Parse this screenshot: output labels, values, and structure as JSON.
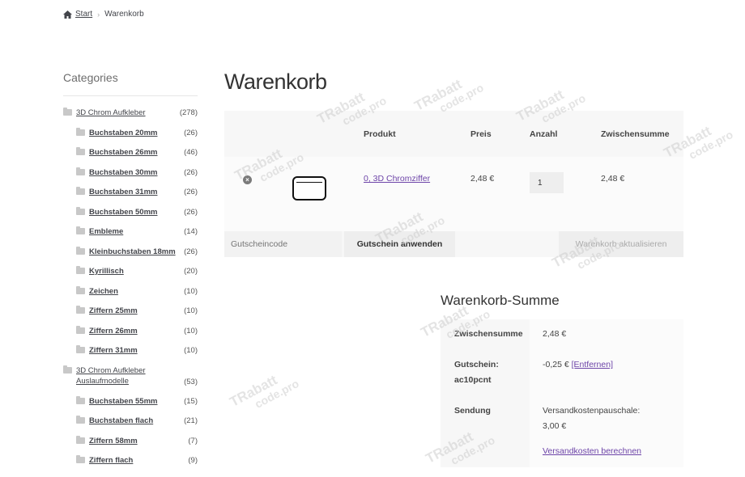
{
  "breadcrumb": {
    "home": "Start",
    "current": "Warenkorb",
    "separator": "›"
  },
  "sidebar": {
    "title": "Categories",
    "categories": [
      {
        "name": "3D Chrom Aufkleber",
        "count": "(278)",
        "level": 0
      },
      {
        "name": "Buchstaben 20mm",
        "count": "(26)",
        "level": 1
      },
      {
        "name": "Buchstaben 26mm",
        "count": "(46)",
        "level": 1
      },
      {
        "name": "Buchstaben 30mm",
        "count": "(26)",
        "level": 1
      },
      {
        "name": "Buchstaben 31mm",
        "count": "(26)",
        "level": 1
      },
      {
        "name": "Buchstaben 50mm",
        "count": "(26)",
        "level": 1
      },
      {
        "name": "Embleme",
        "count": "(14)",
        "level": 1
      },
      {
        "name": "Kleinbuchstaben 18mm",
        "count": "(26)",
        "level": 1
      },
      {
        "name": "Kyrillisch",
        "count": "(20)",
        "level": 1
      },
      {
        "name": "Zeichen",
        "count": "(10)",
        "level": 1
      },
      {
        "name": "Ziffern 25mm",
        "count": "(10)",
        "level": 1
      },
      {
        "name": "Ziffern 26mm",
        "count": "(10)",
        "level": 1
      },
      {
        "name": "Ziffern 31mm",
        "count": "(10)",
        "level": 1
      },
      {
        "name": "3D Chrom Aufkleber Auslaufmodelle",
        "count": "(53)",
        "level": 0
      },
      {
        "name": "Buchstaben 55mm",
        "count": "(15)",
        "level": 1
      },
      {
        "name": "Buchstaben flach",
        "count": "(21)",
        "level": 1
      },
      {
        "name": "Ziffern 58mm",
        "count": "(7)",
        "level": 1
      },
      {
        "name": "Ziffern flach",
        "count": "(9)",
        "level": 1
      }
    ]
  },
  "cart": {
    "title": "Warenkorb",
    "columns": {
      "product": "Produkt",
      "price": "Preis",
      "quantity": "Anzahl",
      "subtotal": "Zwischensumme"
    },
    "items": [
      {
        "remove_icon": "×",
        "product": "0, 3D Chromziffer",
        "price": "2,48 €",
        "quantity": "1",
        "subtotal": "2,48 €"
      }
    ],
    "coupon_placeholder": "Gutscheincode",
    "apply_coupon_label": "Gutschein anwenden",
    "update_cart_label": "Warenkorb aktualisieren"
  },
  "totals": {
    "title": "Warenkorb-Summe",
    "subtotal_label": "Zwischensumme",
    "subtotal_value": "2,48 €",
    "coupon_label_1": "Gutschein:",
    "coupon_label_2": "ac10pcnt",
    "coupon_value": "-0,25 €",
    "coupon_remove": "[Entfernen]",
    "shipping_label": "Sendung",
    "shipping_value_1": "Versandkostenpauschale:",
    "shipping_value_2": "3,00 €",
    "shipping_calc": "Versandkosten berechnen"
  },
  "watermark": {
    "line1": "TRabatt",
    "line2": "code.pro"
  },
  "colors": {
    "link": "#6d44a8",
    "text": "#43454b",
    "table_head_bg": "#f7f7f7",
    "row_bg": "#fbfbfb"
  }
}
